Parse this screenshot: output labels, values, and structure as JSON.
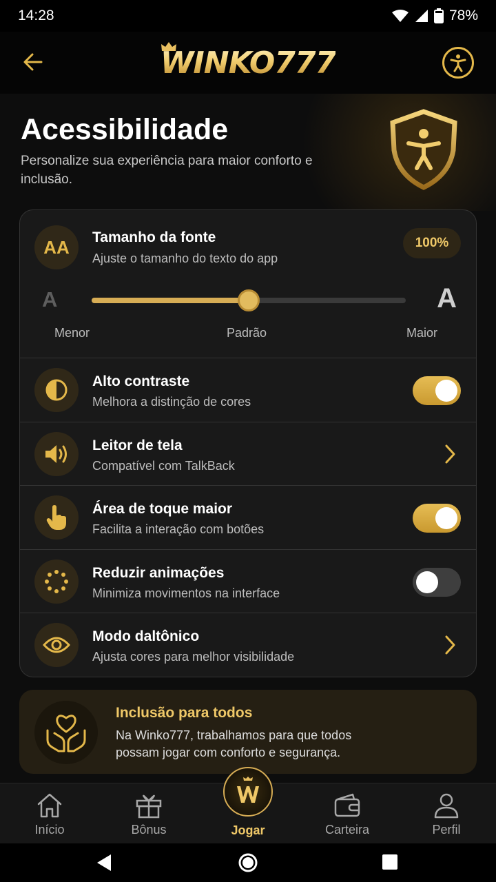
{
  "status_bar": {
    "time": "14:28",
    "battery": "78%"
  },
  "header": {
    "logo_text": "WINKO777"
  },
  "hero": {
    "title": "Acessibilidade",
    "subtitle": "Personalize sua experiência para maior conforto e inclusão."
  },
  "font_size": {
    "title": "Tamanho da fonte",
    "description": "Ajuste o tamanho do texto do app",
    "value_label": "100%",
    "icon_text": "AA",
    "small_glyph": "A",
    "large_glyph": "A",
    "slider_fraction": 0.5,
    "labels": {
      "min": "Menor",
      "mid": "Padrão",
      "max": "Maior"
    }
  },
  "settings": [
    {
      "title": "Alto contraste",
      "description": "Melhora a distinção de cores",
      "icon": "contrast-icon",
      "control": "toggle",
      "enabled": true
    },
    {
      "title": "Leitor de tela",
      "description": "Compatível com TalkBack",
      "icon": "speaker-icon",
      "control": "chevron"
    },
    {
      "title": "Área de toque maior",
      "description": "Facilita a interação com botões",
      "icon": "touch-hand-icon",
      "control": "toggle",
      "enabled": true
    },
    {
      "title": "Reduzir animações",
      "description": "Minimiza movimentos na interface",
      "icon": "dotted-circle-icon",
      "control": "toggle",
      "enabled": false
    },
    {
      "title": "Modo daltônico",
      "description": "Ajusta cores para melhor visibilidade",
      "icon": "eye-icon",
      "control": "chevron"
    }
  ],
  "inclusion": {
    "title": "Inclusão para todos",
    "text": "Na Winko777, trabalhamos para que todos possam jogar com conforto e segurança."
  },
  "bottom_nav": {
    "items": [
      {
        "label": "Início",
        "icon": "home-icon"
      },
      {
        "label": "Bônus",
        "icon": "gift-icon"
      },
      {
        "label": "Jogar",
        "icon": "play-coin-icon",
        "active": true
      },
      {
        "label": "Carteira",
        "icon": "wallet-icon"
      },
      {
        "label": "Perfil",
        "icon": "profile-icon"
      }
    ]
  },
  "colors": {
    "accent": "#e4b84a",
    "background": "#0d0d0d",
    "card": "#191919"
  }
}
